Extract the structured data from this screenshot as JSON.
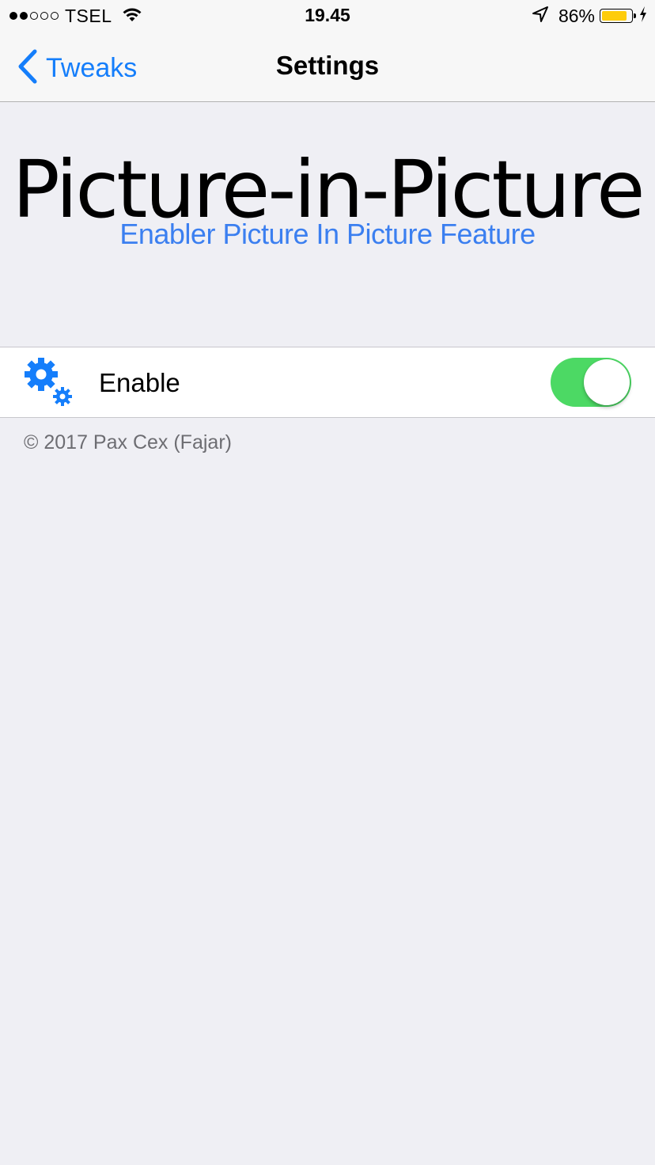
{
  "status_bar": {
    "carrier": "TSEL",
    "signal_bars_filled": 2,
    "signal_bars_total": 5,
    "time": "19.45",
    "battery_percent": "86%",
    "battery_level": 0.86,
    "battery_color": "#fecc0b",
    "icons": [
      "wifi-icon",
      "location-arrow-icon",
      "battery-icon",
      "charging-bolt-icon"
    ]
  },
  "nav": {
    "back_label": "Tweaks",
    "title": "Settings",
    "accent_color": "#157efb"
  },
  "header": {
    "title": "Picture-in-Picture",
    "subtitle": "Enabler Picture In Picture Feature",
    "subtitle_color": "#3b7ff0"
  },
  "settings": {
    "enable": {
      "label": "Enable",
      "icon": "gears-icon",
      "value": true,
      "on_color": "#4cd964"
    }
  },
  "footer": {
    "text": "© 2017 Pax Cex (Fajar)"
  }
}
